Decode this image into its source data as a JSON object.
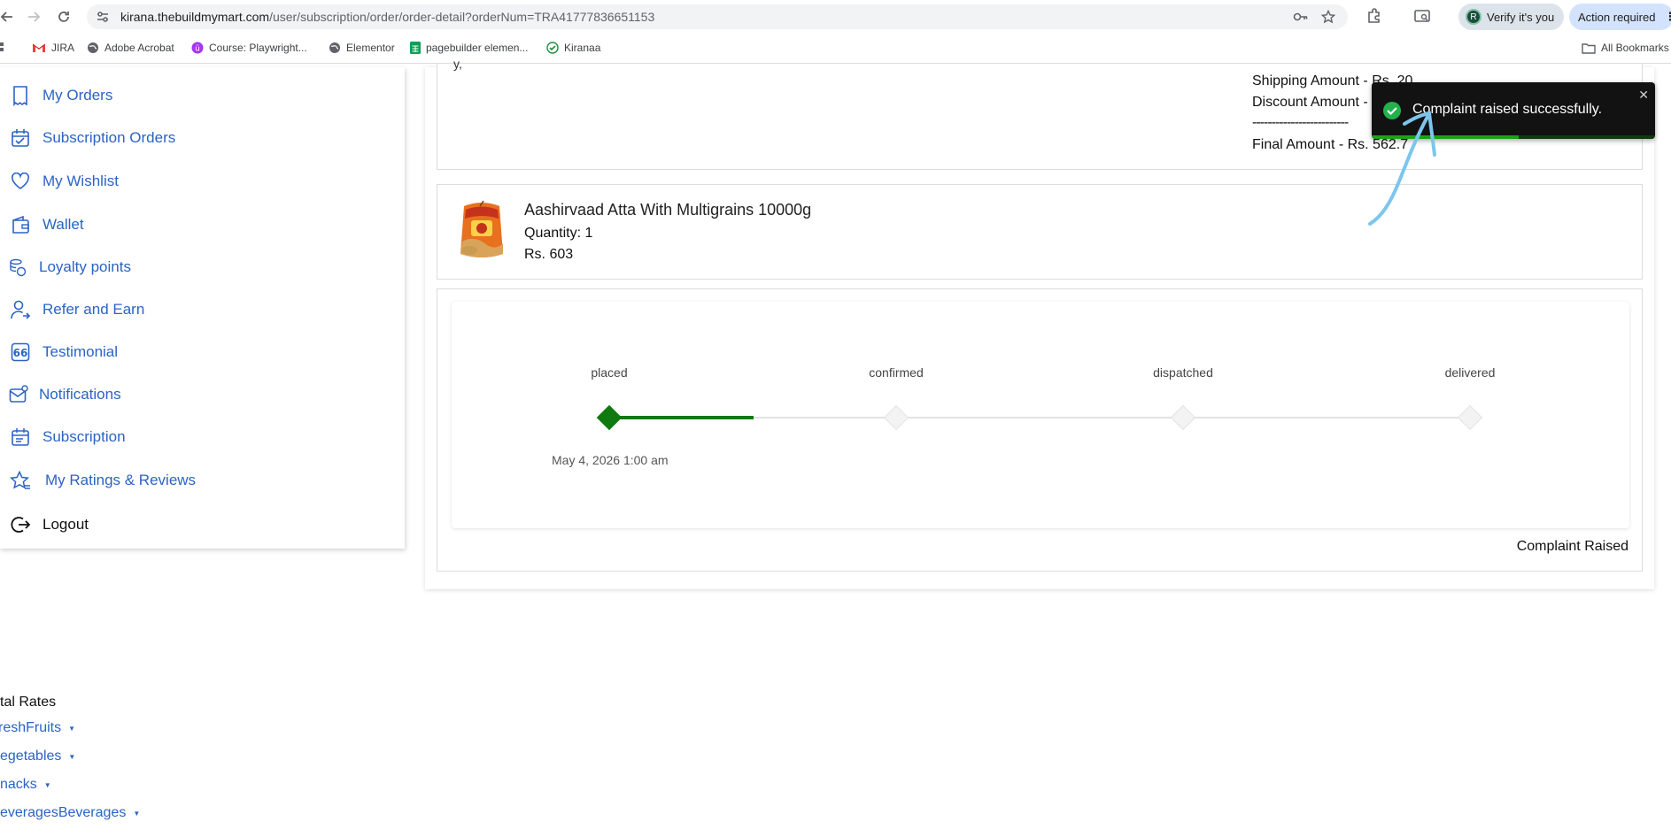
{
  "browser": {
    "url_host": "kirana.thebuildmymart.com",
    "url_path": "/user/subscription/order/order-detail?orderNum=TRA41777836651153",
    "verify_label": "Verify it's you",
    "verify_avatar": "R",
    "action_label": "Action required"
  },
  "bookmarks": [
    {
      "label": "JIRA",
      "icon": "gmail-icon"
    },
    {
      "label": "Adobe Acrobat",
      "icon": "globe-icon"
    },
    {
      "label": "Course: Playwright...",
      "icon": "udemy-icon"
    },
    {
      "label": "Elementor",
      "icon": "globe-icon"
    },
    {
      "label": "pagebuilder elemen...",
      "icon": "sheets-icon"
    },
    {
      "label": "Kiranaa",
      "icon": "check-circle-icon"
    }
  ],
  "all_bookmarks_label": "All Bookmarks",
  "sidebar": {
    "items": [
      {
        "label": "My Orders",
        "icon": "receipt-icon"
      },
      {
        "label": "Subscription Orders",
        "icon": "calendar-icon"
      },
      {
        "label": "My Wishlist",
        "icon": "heart-icon"
      },
      {
        "label": "Wallet",
        "icon": "wallet-icon"
      },
      {
        "label": "Loyalty points",
        "icon": "coins-icon"
      },
      {
        "label": "Refer and Earn",
        "icon": "user-share-icon"
      },
      {
        "label": "Testimonial",
        "icon": "quote-icon"
      },
      {
        "label": "Notifications",
        "icon": "mail-bell-icon"
      },
      {
        "label": "Subscription",
        "icon": "calendar-repeat-icon"
      },
      {
        "label": "My Ratings & Reviews",
        "icon": "star-icon"
      },
      {
        "label": "Logout",
        "icon": "logout-icon"
      }
    ]
  },
  "summary": {
    "partial_label": "y, ",
    "shipping": "Shipping Amount - Rs. 20",
    "discount": "Discount Amount -",
    "separator": "-------------------------",
    "final": "Final Amount - Rs. 562.7"
  },
  "item": {
    "name": "Aashirvaad Atta With Multigrains 10000g",
    "quantity": "Quantity: 1",
    "price": "Rs. 603"
  },
  "tracking": {
    "steps": [
      "placed",
      "confirmed",
      "dispatched",
      "delivered"
    ],
    "completed_steps": 1,
    "placed_date": "May 4, 2026 1:00 am",
    "status": "Complaint Raised"
  },
  "footer": {
    "title": "tal Rates",
    "categories": [
      "reshFruits",
      "egetables",
      "nacks",
      "everagesBeverages"
    ]
  },
  "toast": {
    "message": "Complaint raised successfully.",
    "close": "✕",
    "progress": 0.52
  },
  "colors": {
    "link_blue": "#2b63c6",
    "success_green": "#0f7a0f",
    "toast_bg": "#121212"
  }
}
